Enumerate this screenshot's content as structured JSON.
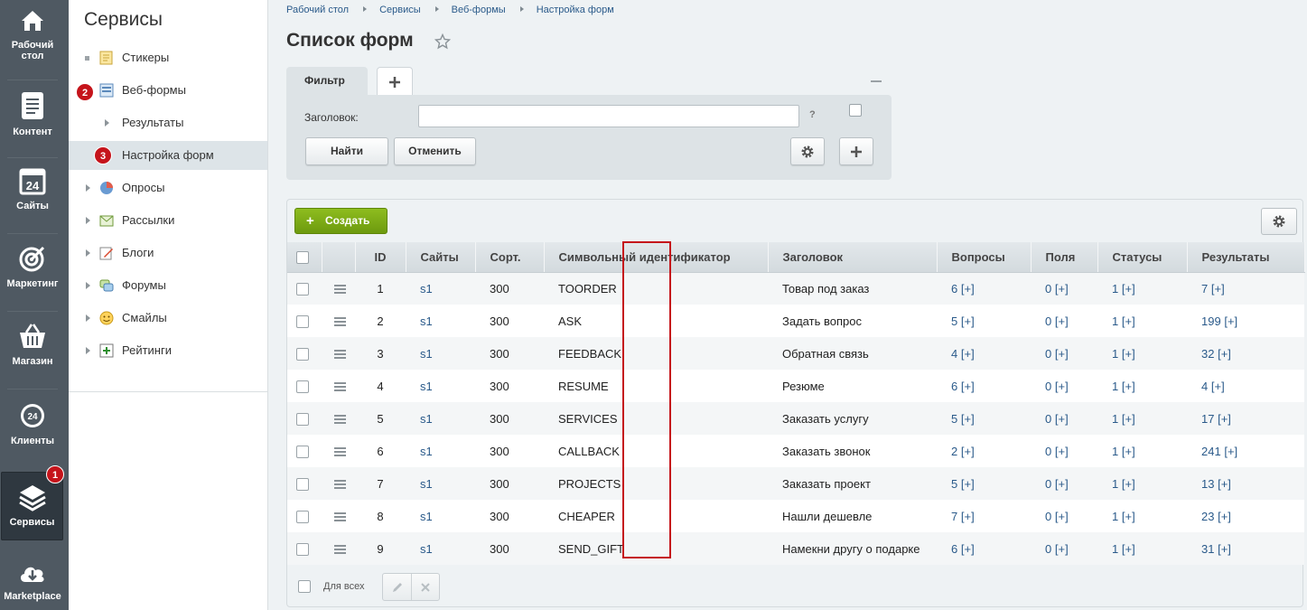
{
  "leftbar": {
    "items": [
      {
        "label": "Рабочий стол"
      },
      {
        "label": "Контент"
      },
      {
        "label": "Сайты"
      },
      {
        "label": "Маркетинг"
      },
      {
        "label": "Магазин"
      },
      {
        "label": "Клиенты"
      },
      {
        "label": "Сервисы"
      },
      {
        "label": "Marketplace"
      }
    ],
    "calendar_number": "24",
    "clients_number": "24"
  },
  "badges": {
    "b1": "1",
    "b2": "2",
    "b3": "3"
  },
  "sidebar": {
    "title": "Сервисы",
    "items": [
      {
        "label": "Стикеры"
      },
      {
        "label": "Веб-формы"
      },
      {
        "label": "Результаты"
      },
      {
        "label": "Настройка форм"
      },
      {
        "label": "Опросы"
      },
      {
        "label": "Рассылки"
      },
      {
        "label": "Блоги"
      },
      {
        "label": "Форумы"
      },
      {
        "label": "Смайлы"
      },
      {
        "label": "Рейтинги"
      }
    ]
  },
  "breadcrumbs": [
    "Рабочий стол",
    "Сервисы",
    "Веб-формы",
    "Настройка форм"
  ],
  "page": {
    "title": "Список форм"
  },
  "filter": {
    "tab_label": "Фильтр",
    "field_label": "Заголовок:",
    "field_value": "",
    "help": "?",
    "find_label": "Найти",
    "cancel_label": "Отменить"
  },
  "toolbar": {
    "create_label": "Создать"
  },
  "table": {
    "headers": [
      "ID",
      "Сайты",
      "Сорт.",
      "Символьный идентификатор",
      "Заголовок",
      "Вопросы",
      "Поля",
      "Статусы",
      "Результаты"
    ],
    "rows": [
      {
        "id": "1",
        "site": "s1",
        "sort": "300",
        "code": "TOORDER",
        "title": "Товар под заказ",
        "questions": "6",
        "fields": "0",
        "statuses": "1",
        "results": "7"
      },
      {
        "id": "2",
        "site": "s1",
        "sort": "300",
        "code": "ASK",
        "title": "Задать вопрос",
        "questions": "5",
        "fields": "0",
        "statuses": "1",
        "results": "199"
      },
      {
        "id": "3",
        "site": "s1",
        "sort": "300",
        "code": "FEEDBACK",
        "title": "Обратная связь",
        "questions": "4",
        "fields": "0",
        "statuses": "1",
        "results": "32"
      },
      {
        "id": "4",
        "site": "s1",
        "sort": "300",
        "code": "RESUME",
        "title": "Резюме",
        "questions": "6",
        "fields": "0",
        "statuses": "1",
        "results": "4"
      },
      {
        "id": "5",
        "site": "s1",
        "sort": "300",
        "code": "SERVICES",
        "title": "Заказать услугу",
        "questions": "5",
        "fields": "0",
        "statuses": "1",
        "results": "17"
      },
      {
        "id": "6",
        "site": "s1",
        "sort": "300",
        "code": "CALLBACK",
        "title": "Заказать звонок",
        "questions": "2",
        "fields": "0",
        "statuses": "1",
        "results": "241"
      },
      {
        "id": "7",
        "site": "s1",
        "sort": "300",
        "code": "PROJECTS",
        "title": "Заказать проект",
        "questions": "5",
        "fields": "0",
        "statuses": "1",
        "results": "13"
      },
      {
        "id": "8",
        "site": "s1",
        "sort": "300",
        "code": "CHEAPER",
        "title": "Нашли дешевле",
        "questions": "7",
        "fields": "0",
        "statuses": "1",
        "results": "23"
      },
      {
        "id": "9",
        "site": "s1",
        "sort": "300",
        "code": "SEND_GIFT",
        "title": "Намекни другу о подарке",
        "questions": "6",
        "fields": "0",
        "statuses": "1",
        "results": "31"
      }
    ],
    "add_link": "[+]"
  },
  "footer": {
    "for_all_label": "Для всех"
  },
  "colors": {
    "accent_green": "#7aa817",
    "badge_red": "#c5141b",
    "link_blue": "#2a5a8a",
    "sidebar_dark": "#4f5962"
  }
}
